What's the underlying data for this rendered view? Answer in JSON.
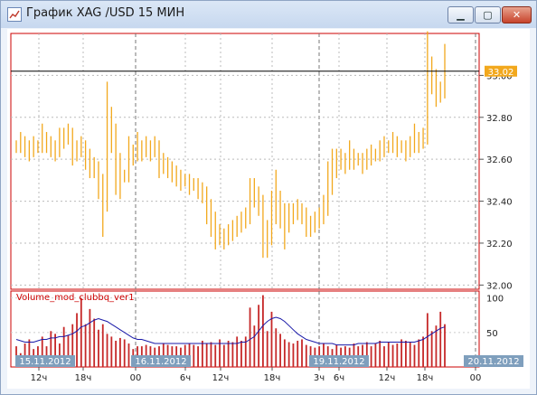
{
  "window": {
    "title": "График XAG /USD  15 МИН",
    "minimize_icon": "minimize-icon",
    "maximize_icon": "maximize-icon",
    "close_icon": "close-icon"
  },
  "colors": {
    "candles": "#f2a81d",
    "volume": "#c62828",
    "volume_ma": "#1a1aa8",
    "price_line": "#000000",
    "price_label_bg": "#f2a81d",
    "date_label_bg": "#7f9fbd"
  },
  "chart_data": [
    {
      "type": "candlestick",
      "title": "",
      "y_ticks": [
        "33.00",
        "32.80",
        "32.60",
        "32.40",
        "32.20",
        "32.00"
      ],
      "ylim": [
        31.98,
        33.2
      ],
      "current_price_label": "33.02",
      "current_price": 33.02,
      "grid": true,
      "series": [
        {
          "name": "",
          "values": [
            32.66,
            32.68,
            32.66,
            32.64,
            32.66,
            32.66,
            32.7,
            32.68,
            32.66,
            32.64,
            32.68,
            32.7,
            32.72,
            32.66,
            32.64,
            32.66,
            32.62,
            32.58,
            32.56,
            32.5,
            32.38,
            32.66,
            32.74,
            32.6,
            32.52,
            32.52,
            32.6,
            32.62,
            32.66,
            32.64,
            32.66,
            32.64,
            32.66,
            32.6,
            32.58,
            32.56,
            32.54,
            32.52,
            32.5,
            32.5,
            32.48,
            32.48,
            32.46,
            32.44,
            32.38,
            32.32,
            32.26,
            32.24,
            32.22,
            32.24,
            32.26,
            32.28,
            32.3,
            32.32,
            32.4,
            32.44,
            32.4,
            32.28,
            32.22,
            32.32,
            32.42,
            32.36,
            32.28,
            32.32,
            32.34,
            32.36,
            32.34,
            32.3,
            32.28,
            32.3,
            32.32,
            32.36,
            32.46,
            32.54,
            32.58,
            32.6,
            32.58,
            32.62,
            32.6,
            32.6,
            32.58,
            32.6,
            32.62,
            32.62,
            32.64,
            32.66,
            32.66,
            32.68,
            32.66,
            32.66,
            32.64,
            32.66,
            32.7,
            32.68,
            32.7,
            32.94,
            33.0,
            32.94,
            32.92,
            33.02
          ]
        }
      ]
    },
    {
      "type": "bar",
      "title": "Volume_mod_clubbq_ver1",
      "y_ticks": [
        "100",
        "50"
      ],
      "ylim": [
        0,
        110
      ],
      "series": [
        {
          "name": "Volume_mod_clubbq_ver1",
          "values": [
            30,
            20,
            34,
            40,
            26,
            30,
            44,
            30,
            52,
            48,
            34,
            58,
            46,
            62,
            78,
            100,
            62,
            84,
            70,
            54,
            62,
            48,
            44,
            38,
            42,
            40,
            34,
            26,
            30,
            30,
            32,
            30,
            28,
            30,
            34,
            32,
            30,
            30,
            28,
            32,
            34,
            32,
            30,
            38,
            34,
            36,
            32,
            40,
            32,
            38,
            36,
            44,
            38,
            44,
            86,
            60,
            90,
            104,
            52,
            80,
            56,
            48,
            40,
            36,
            34,
            38,
            40,
            32,
            30,
            28,
            30,
            34,
            30,
            26,
            32,
            28,
            30,
            28,
            34,
            30,
            32,
            36,
            30,
            34,
            38,
            30,
            36,
            32,
            34,
            40,
            38,
            36,
            32,
            40,
            44,
            78,
            52,
            60,
            80,
            62
          ]
        },
        {
          "name": "",
          "values": [
            40,
            38,
            36,
            36,
            36,
            38,
            40,
            40,
            42,
            42,
            44,
            44,
            46,
            48,
            52,
            58,
            60,
            64,
            68,
            70,
            68,
            66,
            62,
            58,
            54,
            50,
            46,
            42,
            40,
            40,
            38,
            36,
            34,
            34,
            34,
            34,
            34,
            34,
            34,
            34,
            34,
            34,
            34,
            34,
            34,
            34,
            34,
            34,
            34,
            34,
            34,
            34,
            36,
            36,
            40,
            44,
            52,
            60,
            66,
            70,
            72,
            70,
            66,
            60,
            54,
            48,
            44,
            40,
            38,
            36,
            34,
            34,
            34,
            34,
            32,
            32,
            32,
            32,
            32,
            34,
            34,
            34,
            34,
            34,
            36,
            36,
            36,
            36,
            36,
            36,
            36,
            36,
            36,
            38,
            40,
            44,
            48,
            52,
            56,
            58
          ]
        }
      ]
    }
  ],
  "x_axis": {
    "labels": [
      "12ч",
      "18ч",
      "00",
      "6ч",
      "12ч",
      "18ч",
      "3ч",
      "6ч",
      "12ч",
      "18ч",
      "00"
    ],
    "date_labels": [
      "15.11.2012",
      "16.11.2012",
      "19.11.2012",
      "20.11.2012"
    ]
  }
}
